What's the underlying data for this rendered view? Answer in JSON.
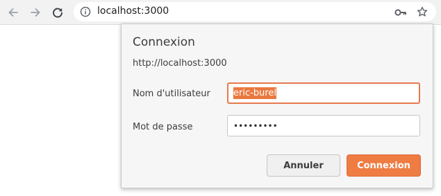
{
  "browser": {
    "url": "localhost:3000",
    "icons": {
      "back": "back-arrow-icon",
      "forward": "forward-arrow-icon",
      "reload": "reload-icon",
      "info": "info-icon",
      "key": "key-icon",
      "star": "star-icon"
    }
  },
  "dialog": {
    "title": "Connexion",
    "origin": "http://localhost:3000",
    "username_label": "Nom d'utilisateur",
    "username_value": "eric-burel",
    "password_label": "Mot de passe",
    "password_value": "•••••••••",
    "cancel_label": "Annuler",
    "submit_label": "Connexion"
  },
  "colors": {
    "accent": "#ee7c43",
    "focus_border": "#e5794c",
    "toolbar_bg": "#f2f2f2",
    "dialog_bg": "#f6f6f6"
  }
}
